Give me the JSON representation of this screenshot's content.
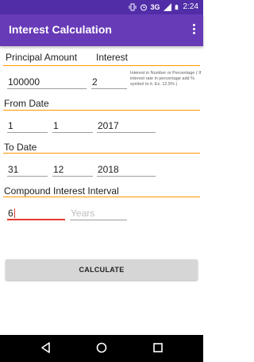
{
  "status_bar": {
    "network": "3G",
    "time": "2:24"
  },
  "app_bar": {
    "title": "Interest Calculation",
    "overflow_icon": "more-vert-icon"
  },
  "principal": {
    "label": "Principal Amount",
    "value": "100000"
  },
  "interest": {
    "label": "Interest",
    "value": "2",
    "hint": "Interest in Number or Percentage ( If interest rate in percentage add % symbol to it. Ex. 12.5% )"
  },
  "from_date": {
    "label": "From Date",
    "day": "1",
    "month": "1",
    "year": "2017"
  },
  "to_date": {
    "label": "To Date",
    "day": "31",
    "month": "12",
    "year": "2018"
  },
  "compound": {
    "label": "Compound Interest Interval",
    "value": "6",
    "unit_placeholder": "Years"
  },
  "calculate_button": {
    "label": "CALCULATE"
  },
  "colors": {
    "app_bar": "#673ab7",
    "status_bar": "#512da8",
    "section_line": "#ff9800",
    "focus": "#e53935"
  }
}
